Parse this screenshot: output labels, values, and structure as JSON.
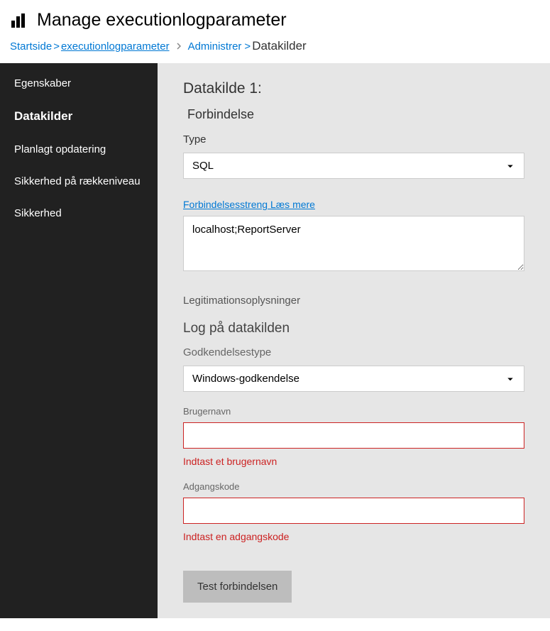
{
  "header": {
    "title": "Manage executionlogparameter"
  },
  "breadcrumb": {
    "home": "Startside",
    "home_sep": ">",
    "item": "executionlogparameter",
    "admin": "Administrer",
    "admin_sep": ">",
    "current": "Datakilder"
  },
  "sidebar": {
    "items": [
      {
        "label": "Egenskaber"
      },
      {
        "label": "Datakilder"
      },
      {
        "label": "Planlagt opdatering"
      },
      {
        "label": "Sikkerhed på rækkeniveau"
      },
      {
        "label": "Sikkerhed"
      }
    ],
    "active_index": 1
  },
  "main": {
    "ds_title": "Datakilde 1:",
    "connection_header": "Forbindelse",
    "type_label": "Type",
    "type_value": "SQL",
    "conn_string_label": "Forbindelsesstreng Læs mere",
    "conn_string_value": "localhost;ReportServer",
    "credentials_label": "Legitimationsoplysninger",
    "login_header": "Log på datakilden",
    "auth_type_label": "Godkendelsestype",
    "auth_type_value": "Windows-godkendelse",
    "username_label": "Brugernavn",
    "username_value": "",
    "username_error": "Indtast et brugernavn",
    "password_label": "Adgangskode",
    "password_value": "",
    "password_error": "Indtast en adgangskode",
    "test_button": "Test forbindelsen"
  }
}
